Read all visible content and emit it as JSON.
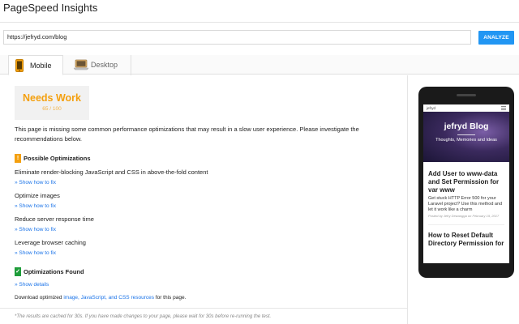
{
  "header": {
    "title": "PageSpeed Insights"
  },
  "search": {
    "url_value": "https://jefryd.com/blog",
    "analyze_label": "ANALYZE"
  },
  "tabs": [
    {
      "label": "Mobile",
      "icon": "phone-icon",
      "active": true
    },
    {
      "label": "Desktop",
      "icon": "laptop-icon",
      "active": false
    }
  ],
  "score": {
    "label": "Needs Work",
    "value": "65 / 100",
    "color": "#f4a00f"
  },
  "intro": "This page is missing some common performance optimizations that may result in a slow user experience. Please investigate the recommendations below.",
  "possible": {
    "heading": "Possible Optimizations",
    "icon": "warning-icon",
    "items": [
      {
        "title": "Eliminate render-blocking JavaScript and CSS in above-the-fold content",
        "link": "Show how to fix"
      },
      {
        "title": "Optimize images",
        "link": "Show how to fix"
      },
      {
        "title": "Reduce server response time",
        "link": "Show how to fix"
      },
      {
        "title": "Leverage browser caching",
        "link": "Show how to fix"
      }
    ]
  },
  "found": {
    "heading": "Optimizations Found",
    "icon": "check-icon",
    "link": "Show details"
  },
  "download": {
    "prefix": "Download optimized ",
    "link": "image, JavaScript, and CSS resources",
    "suffix": " for this page."
  },
  "footnote": "*The results are cached for 30s. If you have made changes to your page, please wait for 30s before re-running the test.",
  "phone": {
    "site_name": "jefryd",
    "hero_title": "jefryd Blog",
    "hero_tagline": "Thoughts, Memories and Ideas",
    "post1_title": "Add User to www-data and Set Permission for var www",
    "post1_excerpt": "Get stuck HTTP Error 500 for your Laravel project? Use this method and let it work like a charm",
    "post1_meta": "Posted by Jefry Dewangga on February 19, 2017",
    "post2_title": "How to Reset Default Directory Permission for"
  },
  "colors": {
    "accent": "#2196f3",
    "warning": "#f4a00f",
    "success": "#1f9d3a",
    "link": "#1a73e8"
  }
}
